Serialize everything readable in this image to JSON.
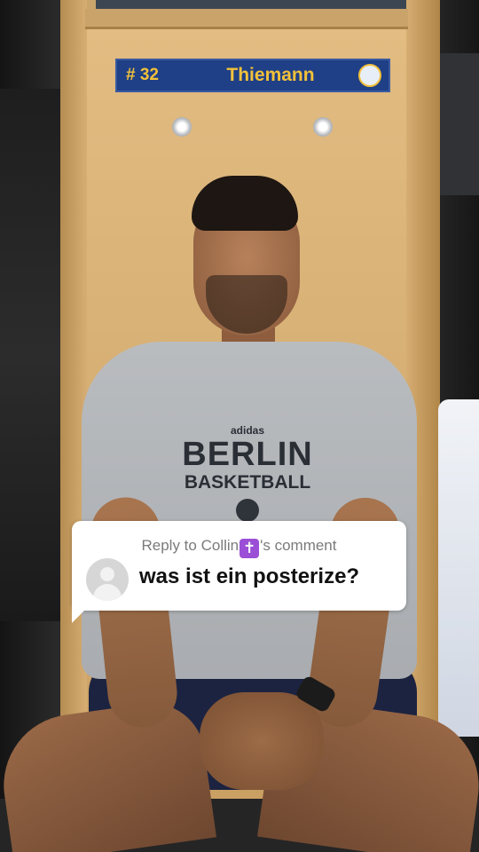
{
  "nameplate": {
    "number": "# 32",
    "name": "Thiemann",
    "logo_icon": "alba-berlin-logo"
  },
  "shirt": {
    "brand": "adidas",
    "line1": "BERLIN",
    "line2": "BASKETBALL"
  },
  "reply": {
    "prefix": "Reply to Collin",
    "emoji": "✝",
    "suffix": "'s comment",
    "text": "was ist ein posterize?",
    "avatar_icon": "default-avatar-icon",
    "emoji_color": "#9b4fd6"
  },
  "colors": {
    "nameplate_bg": "#1f3f86",
    "nameplate_text": "#f2c13a",
    "bubble_bg": "#ffffff"
  }
}
